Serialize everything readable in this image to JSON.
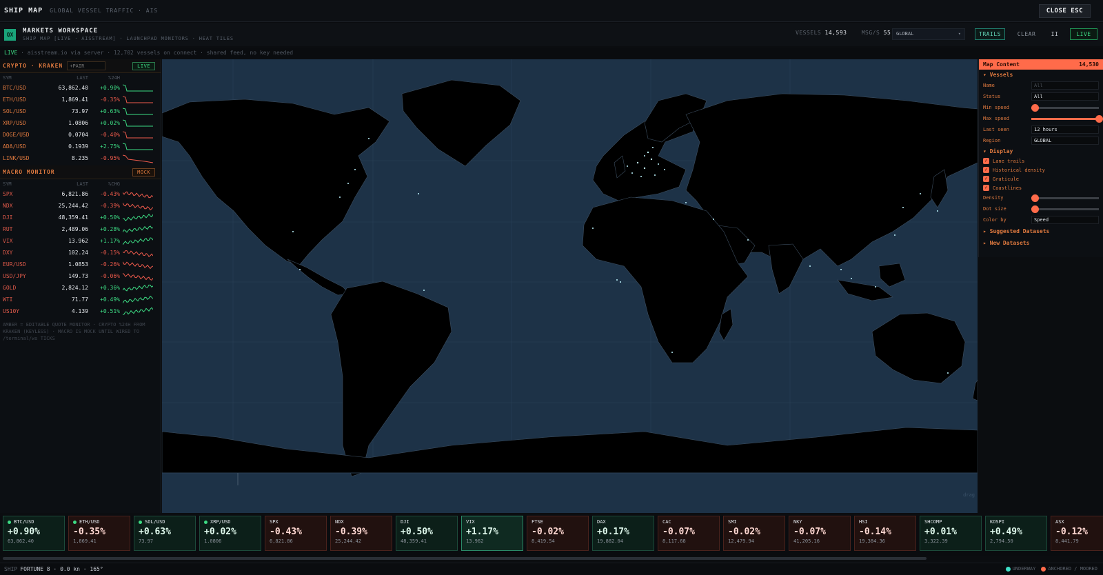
{
  "titlebar": {
    "title": "SHIP MAP",
    "subtitle": "GLOBAL VESSEL TRAFFIC · AIS",
    "close_label": "CLOSE ESC"
  },
  "workspace": {
    "logo": "QX",
    "title": "MARKETS WORKSPACE",
    "subtitle": "SHIP MAP [LIVE · AISSTREAM] · LAUNCHPAD MONITORS · HEAT TILES",
    "vessels_label": "VESSELS",
    "vessels_value": "14,593",
    "msgs_label": "MSG/S",
    "msgs_value": "55",
    "region": "GLOBAL",
    "trails_label": "TRAILS",
    "clear_label": "CLEAR",
    "pause_label": "II",
    "live_label": "LIVE"
  },
  "livestrip": {
    "live": "LIVE",
    "text": " · aisstream.io via server · 12,702 vessels on connect · shared feed, no key needed"
  },
  "crypto": {
    "title": "CRYPTO · KRAKEN",
    "pair_placeholder": "+PAIR",
    "badge": "LIVE",
    "headers": [
      "SYM",
      "LAST",
      "%24H"
    ],
    "rows": [
      {
        "sym": "BTC/USD",
        "last": "63,862.40",
        "chg": "+0.90%",
        "dir": "pos",
        "spark": "drop-flat"
      },
      {
        "sym": "ETH/USD",
        "last": "1,869.41",
        "chg": "-0.35%",
        "dir": "neg",
        "spark": "drop-flat"
      },
      {
        "sym": "SOL/USD",
        "last": "73.97",
        "chg": "+0.63%",
        "dir": "pos",
        "spark": "drop-flat"
      },
      {
        "sym": "XRP/USD",
        "last": "1.0806",
        "chg": "+0.02%",
        "dir": "pos",
        "spark": "drop-flat"
      },
      {
        "sym": "DOGE/USD",
        "last": "0.0704",
        "chg": "-0.40%",
        "dir": "neg",
        "spark": "drop-flat"
      },
      {
        "sym": "ADA/USD",
        "last": "0.1939",
        "chg": "+2.75%",
        "dir": "pos",
        "spark": "drop-flat"
      },
      {
        "sym": "LINK/USD",
        "last": "8.235",
        "chg": "-0.95%",
        "dir": "neg",
        "spark": "decline"
      }
    ]
  },
  "macro": {
    "title": "MACRO MONITOR",
    "badge": "MOCK",
    "headers": [
      "SYM",
      "LAST",
      "%CHG"
    ],
    "rows": [
      {
        "sym": "SPX",
        "last": "6,821.86",
        "chg": "-0.43%",
        "dir": "neg"
      },
      {
        "sym": "NDX",
        "last": "25,244.42",
        "chg": "-0.39%",
        "dir": "neg"
      },
      {
        "sym": "DJI",
        "last": "48,359.41",
        "chg": "+0.50%",
        "dir": "pos"
      },
      {
        "sym": "RUT",
        "last": "2,489.06",
        "chg": "+0.28%",
        "dir": "pos"
      },
      {
        "sym": "VIX",
        "last": "13.962",
        "chg": "+1.17%",
        "dir": "pos"
      },
      {
        "sym": "DXY",
        "last": "102.24",
        "chg": "-0.15%",
        "dir": "neg"
      },
      {
        "sym": "EUR/USD",
        "last": "1.0853",
        "chg": "-0.26%",
        "dir": "neg"
      },
      {
        "sym": "USD/JPY",
        "last": "149.73",
        "chg": "-0.06%",
        "dir": "neg"
      },
      {
        "sym": "GOLD",
        "last": "2,824.12",
        "chg": "+0.36%",
        "dir": "pos"
      },
      {
        "sym": "WTI",
        "last": "71.77",
        "chg": "+0.49%",
        "dir": "pos"
      },
      {
        "sym": "US10Y",
        "last": "4.139",
        "chg": "+0.51%",
        "dir": "pos"
      }
    ],
    "note": "AMBER = EDITABLE QUOTE MONITOR · CRYPTO %24H FROM KRAKEN (KEYLESS) · MACRO IS MOCK UNTIL WIRED TO /terminal/ws TICKS"
  },
  "map": {
    "drag_hint": "drag"
  },
  "map_content": {
    "title": "Map Content",
    "count": "14,530",
    "vessels_section": "▾ Vessels",
    "fields": {
      "name_label": "Name",
      "name_placeholder": "All",
      "status_label": "Status",
      "status_value": "All",
      "min_speed_label": "Min speed",
      "min_speed_level": 0.05,
      "max_speed_label": "Max speed",
      "max_speed_level": 1.0,
      "last_seen_label": "Last seen",
      "last_seen_value": "12 hours",
      "region_label": "Region",
      "region_value": "GLOBAL"
    },
    "display_section": "▾ Display",
    "checks": [
      "Lane trails",
      "Historical density",
      "Graticule",
      "Coastlines"
    ],
    "density_label": "Density",
    "density_level": 0.05,
    "dotsize_label": "Dot size",
    "dotsize_level": 0.05,
    "colorby_label": "Color by",
    "colorby_value": "Speed",
    "suggested": "▸ Suggested Datasets",
    "new_datasets": "▸ New Datasets"
  },
  "tiles": [
    {
      "sym": "BTC/USD",
      "chg": "+0.90%",
      "last": "63,862.40",
      "dir": "pos",
      "live": true
    },
    {
      "sym": "ETH/USD",
      "chg": "-0.35%",
      "last": "1,869.41",
      "dir": "neg",
      "live": true
    },
    {
      "sym": "SOL/USD",
      "chg": "+0.63%",
      "last": "73.97",
      "dir": "pos",
      "live": true
    },
    {
      "sym": "XRP/USD",
      "chg": "+0.02%",
      "last": "1.0806",
      "dir": "pos",
      "live": true
    },
    {
      "sym": "SPX",
      "chg": "-0.43%",
      "last": "6,821.86",
      "dir": "neg",
      "live": false
    },
    {
      "sym": "NDX",
      "chg": "-0.39%",
      "last": "25,244.42",
      "dir": "neg",
      "live": false
    },
    {
      "sym": "DJI",
      "chg": "+0.50%",
      "last": "48,359.41",
      "dir": "pos",
      "live": false
    },
    {
      "sym": "VIX",
      "chg": "+1.17%",
      "last": "13.962",
      "dir": "pos",
      "live": false,
      "highlight": true
    },
    {
      "sym": "FTSE",
      "chg": "-0.02%",
      "last": "8,419.54",
      "dir": "neg",
      "live": false
    },
    {
      "sym": "DAX",
      "chg": "+0.17%",
      "last": "19,882.04",
      "dir": "pos",
      "live": false
    },
    {
      "sym": "CAC",
      "chg": "-0.07%",
      "last": "8,117.68",
      "dir": "neg",
      "live": false
    },
    {
      "sym": "SMI",
      "chg": "-0.02%",
      "last": "12,479.94",
      "dir": "neg",
      "live": false
    },
    {
      "sym": "NKY",
      "chg": "-0.07%",
      "last": "41,205.16",
      "dir": "neg",
      "live": false
    },
    {
      "sym": "HSI",
      "chg": "-0.14%",
      "last": "19,384.36",
      "dir": "neg",
      "live": false
    },
    {
      "sym": "SHCOMP",
      "chg": "+0.01%",
      "last": "3,322.39",
      "dir": "pos",
      "live": false
    },
    {
      "sym": "KOSPI",
      "chg": "+0.49%",
      "last": "2,794.50",
      "dir": "pos",
      "live": false
    },
    {
      "sym": "ASX",
      "chg": "-0.12%",
      "last": "8,441.79",
      "dir": "neg",
      "live": false
    }
  ],
  "status": {
    "prefix": "SHIP",
    "vessel": "FORTUNE 8 · 0.0 kn · 165°",
    "legend_underway": "UNDERWAY",
    "legend_anchored": "ANCHORED / MOORED"
  },
  "colors": {
    "accent": "#ff6b4a",
    "amber": "#e07a3f",
    "positive": "#3ddc84",
    "negative": "#ef5b4c",
    "ocean": "#1d3247",
    "land": "#000000",
    "underway": "#3ee0c8",
    "anchored": "#ff6b4a"
  }
}
